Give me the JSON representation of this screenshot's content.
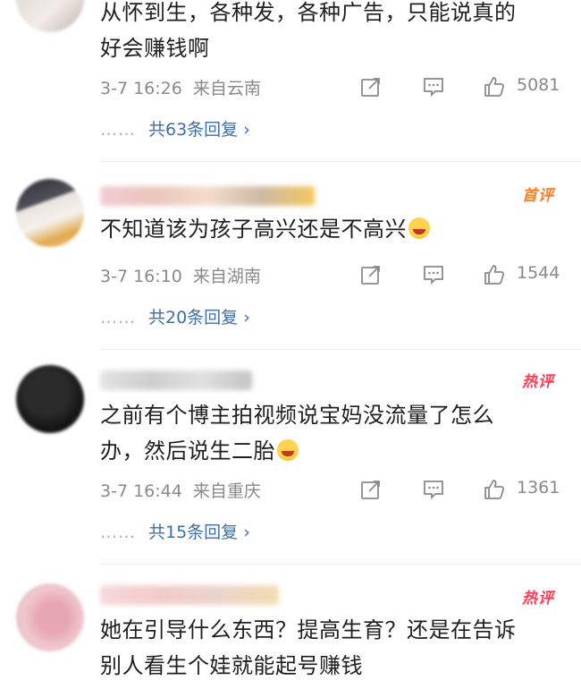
{
  "comments": [
    {
      "badge": "",
      "text_lines": [
        "从怀到生，各种发，各种广告，只能说真的",
        "好会赚钱啊"
      ],
      "time": "3-7 16:26",
      "location": "来自云南",
      "likes": "5081",
      "replies": "共63条回复 ›",
      "reply_prefix": "……"
    },
    {
      "badge": "首评",
      "text_lines": [
        "不知道该为孩子高兴还是不高兴"
      ],
      "time": "3-7 16:10",
      "location": "来自湖南",
      "likes": "1544",
      "replies": "共20条回复 ›",
      "reply_prefix": "……"
    },
    {
      "badge": "热评",
      "text_lines": [
        "之前有个博主拍视频说宝妈没流量了怎么",
        "办，然后说生二胎"
      ],
      "time": "3-7 16:44",
      "location": "来自重庆",
      "likes": "1361",
      "replies": "共15条回复 ›",
      "reply_prefix": "……"
    },
    {
      "badge": "热评",
      "text_lines": [
        "她在引导什么东西？提高生育？还是在告诉",
        "别人看生个娃就能起号赚钱"
      ],
      "time": "",
      "location": "",
      "likes": "",
      "replies": "",
      "reply_prefix": ""
    }
  ],
  "icons": {
    "share": "share-icon",
    "comment": "comment-icon",
    "like": "thumbs-up-icon",
    "emoji": "laughing-emoji-icon"
  },
  "colors": {
    "link": "#3f6ea8",
    "meta": "#8a8a8a",
    "badge_first": "#ff7d1f",
    "badge_hot": "#ff3b54"
  }
}
